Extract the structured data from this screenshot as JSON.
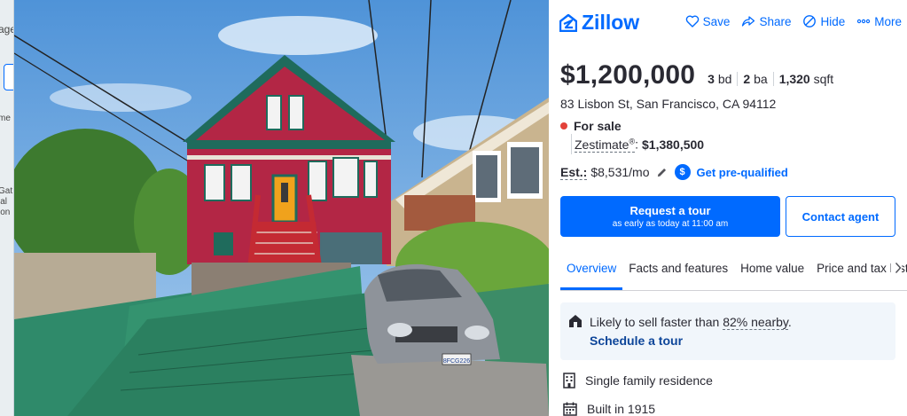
{
  "left_strip": {
    "fragments": [
      "age",
      "me",
      "Gat",
      "ial",
      "ion"
    ]
  },
  "photo": {
    "alt_subject": "house-photo",
    "license_plate": "8FCG226"
  },
  "header": {
    "logo_text": "Zillow",
    "actions": [
      {
        "label": "Save",
        "icon": "heart-icon"
      },
      {
        "label": "Share",
        "icon": "share-icon"
      },
      {
        "label": "Hide",
        "icon": "hide-icon"
      },
      {
        "label": "More",
        "icon": "more-icon"
      }
    ]
  },
  "listing": {
    "price": "$1,200,000",
    "beds_num": "3",
    "beds_unit": "bd",
    "baths_num": "2",
    "baths_unit": "ba",
    "sqft_num": "1,320",
    "sqft_unit": "sqft",
    "address": "83 Lisbon St, San Francisco, CA 94112",
    "status": "For sale",
    "status_color": "#e3423a",
    "zestimate_label": "Zestimate",
    "zestimate_sup": "®",
    "zestimate_colon": ":",
    "zestimate_value": "$1,380,500",
    "est_label": "Est.:",
    "est_value": "$8,531/mo",
    "prequal_icon_text": "$",
    "prequal_label": "Get pre-qualified"
  },
  "buttons": {
    "tour_title": "Request a tour",
    "tour_subtitle": "as early as today at 11:00 am",
    "contact": "Contact agent"
  },
  "tabs": [
    {
      "label": "Overview",
      "active": true
    },
    {
      "label": "Facts and features",
      "active": false
    },
    {
      "label": "Home value",
      "active": false
    },
    {
      "label": "Price and tax hist",
      "active": false
    }
  ],
  "callout": {
    "text_before": "Likely to sell faster than ",
    "pct": "82% nearby",
    "text_after": ".",
    "link": "Schedule a tour"
  },
  "features": [
    {
      "label": "Single family residence",
      "icon": "building-icon"
    },
    {
      "label": "Built in 1915",
      "icon": "calendar-icon"
    }
  ],
  "colors": {
    "brand": "#006aff",
    "text": "#2a2a33",
    "callout_bg": "#f1f6fb",
    "link_dark": "#0d4599"
  }
}
